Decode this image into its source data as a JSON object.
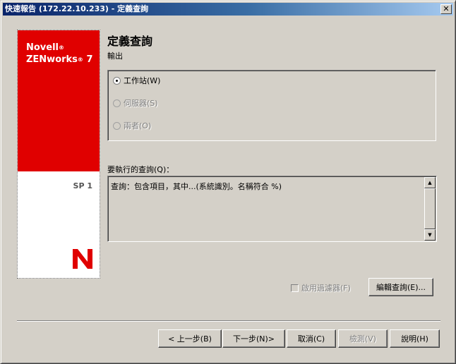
{
  "window": {
    "title": "快速報告 (172.22.10.233) - 定義查詢",
    "close_glyph": "✕"
  },
  "brand": {
    "line1": "Novell",
    "line2": "ZENworks",
    "line2_suffix": " 7",
    "reg_mark": "®",
    "sp": "SP 1",
    "logo_color": "#e00000"
  },
  "header": {
    "title": "定義查詢",
    "subtitle": "輸出"
  },
  "output_options": [
    {
      "label": "工作站(W)",
      "checked": true,
      "enabled": true
    },
    {
      "label": "伺服器(S)",
      "checked": false,
      "enabled": false
    },
    {
      "label": "兩者(O)",
      "checked": false,
      "enabled": false
    }
  ],
  "query": {
    "label": "要執行的查詢(Q)：",
    "text": "查詢：包含項目，其中...(系統識別。名稱符合 %)"
  },
  "filter": {
    "label": "啟用過濾器(F)",
    "checked": false,
    "enabled": false
  },
  "edit_button": {
    "label": "編輯查詢(E)..."
  },
  "buttons": {
    "back": "< 上一步(B)",
    "next": "下一步(N)>",
    "cancel": "取消(C)",
    "check": "檢測(V)",
    "help": "說明(H)"
  }
}
